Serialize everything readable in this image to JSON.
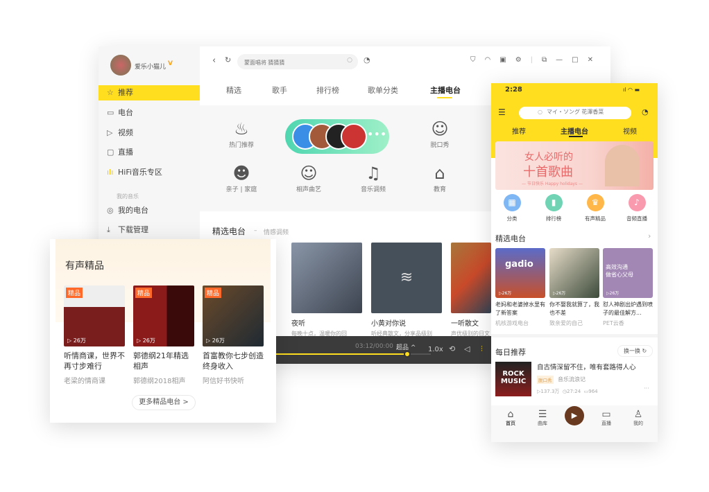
{
  "desktop": {
    "user": {
      "name": "爱乐小猫儿",
      "badge": "V"
    },
    "sidebar": {
      "items": [
        {
          "label": "推荐",
          "icon": "star-icon",
          "active": true
        },
        {
          "label": "电台",
          "icon": "radio-icon"
        },
        {
          "label": "视频",
          "icon": "video-icon"
        },
        {
          "label": "直播",
          "icon": "live-icon"
        },
        {
          "label": "HiFi音乐专区",
          "icon": "hifi-icon"
        }
      ],
      "section": "我的音乐",
      "my_items": [
        {
          "label": "我的电台",
          "icon": "radio-station-icon"
        },
        {
          "label": "下载管理",
          "icon": "download-icon"
        }
      ]
    },
    "search": {
      "placeholder": "蒙面唱将 猜猜猜"
    },
    "tabs": [
      {
        "label": "精选"
      },
      {
        "label": "歌手"
      },
      {
        "label": "排行榜"
      },
      {
        "label": "歌单分类"
      },
      {
        "label": "主播电台",
        "active": true
      }
    ],
    "categories": [
      {
        "label": "热门推荐",
        "icon": "flame-icon"
      },
      {
        "label": "脱口秀",
        "icon": "smile-icon"
      },
      {
        "label": "亲子 | 家庭",
        "icon": "child-icon"
      },
      {
        "label": "相声曲艺",
        "icon": "mask-icon"
      },
      {
        "label": "音乐调频",
        "icon": "music-note-icon"
      },
      {
        "label": "教育",
        "icon": "graduation-cap-icon"
      }
    ],
    "section_title": "精选电台",
    "section_sub": "情感调频",
    "cards": [
      {
        "title": "夜听",
        "sub": "每晚十点，温暖你的回"
      },
      {
        "title": "小黄对你说",
        "sub": "听经典散文，分享品级别"
      },
      {
        "title": "一听散文",
        "sub": "声优级别的日文"
      }
    ],
    "player": {
      "time": "03:12/00:00",
      "quality": "超品 ^",
      "speed": "1.0x",
      "progress": 0.85
    },
    "accent": "#ffdd1f"
  },
  "overlay": {
    "title": "有声精品",
    "badge": "精品",
    "items": [
      {
        "title": "听情商课，世界不再寸步难行",
        "sub": "老梁的情商课",
        "plays": "26万"
      },
      {
        "title": "郭德纲21年精选相声",
        "sub": "郭德纲2018相声",
        "plays": "26万"
      },
      {
        "title": "首富教你七步创造终身收入",
        "sub": "阿信好书快听",
        "plays": "26万"
      }
    ],
    "more": "更多精品电台 >"
  },
  "phone": {
    "time": "2:28",
    "search_placeholder": "マイ・ソング 花澤香菜",
    "tabs": [
      {
        "label": "推荐"
      },
      {
        "label": "主播电台",
        "active": true
      },
      {
        "label": "视频"
      }
    ],
    "banner": {
      "title1": "女人必听的",
      "title2": "十首歌曲",
      "sub": "— 节日快乐 Happy holidays —"
    },
    "quick": [
      {
        "label": "分类",
        "color": "#7fb7f5",
        "icon": "grid-icon"
      },
      {
        "label": "排行榜",
        "color": "#6fd3b4",
        "icon": "bar-chart-icon"
      },
      {
        "label": "有声精品",
        "color": "#ffb74a",
        "icon": "crown-icon"
      },
      {
        "label": "音频直播",
        "color": "#f99aae",
        "icon": "microphone-icon"
      }
    ],
    "section": "精选电台",
    "cards": [
      {
        "title": "老妈和老婆掉水里有了新答案",
        "sub": "机核游戏电台",
        "plays": "26万",
        "cover": "gadio"
      },
      {
        "title": "你不娶我就算了，我也不差",
        "sub": "致亲爱的自己",
        "plays": "26万"
      },
      {
        "title": "怼人神剧出炉遇到喷子的最佳解方...",
        "sub": "PET云香",
        "plays": "26万",
        "cover": "高效沟通 做省心父母"
      }
    ],
    "daily": {
      "title": "每日推荐",
      "refresh": "换一换",
      "item": {
        "title": "自古情深留不住，唯有套路得人心",
        "tag": "脱口秀",
        "author": "音乐流浪记",
        "plays": "137.3万",
        "duration": "27:24",
        "comments": "964",
        "cover": "ROCK MUSIC"
      }
    },
    "nav": [
      {
        "label": "首页",
        "icon": "home-icon",
        "active": true
      },
      {
        "label": "曲库",
        "icon": "library-icon"
      },
      {
        "label": "",
        "icon": "play-disc-icon"
      },
      {
        "label": "直播",
        "icon": "live-camera-icon"
      },
      {
        "label": "我的",
        "icon": "person-icon"
      }
    ]
  }
}
